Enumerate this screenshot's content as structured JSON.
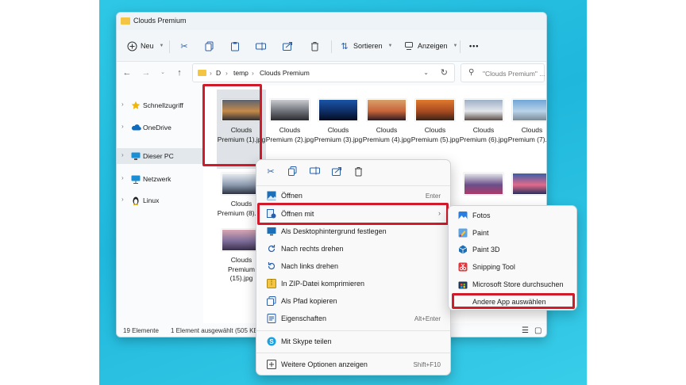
{
  "window": {
    "title": "Clouds Premium"
  },
  "toolbar": {
    "new_label": "Neu",
    "sort_label": "Sortieren",
    "view_label": "Anzeigen",
    "more_label": "•••"
  },
  "address": {
    "crumbs": [
      "D",
      "temp",
      "Clouds Premium"
    ],
    "search_placeholder": "\"Clouds Premium\" ..."
  },
  "sidebar": {
    "items": [
      {
        "label": "Schnellzugriff",
        "icon": "star-icon"
      },
      {
        "label": "OneDrive",
        "icon": "cloud-icon"
      },
      {
        "label": "Dieser PC",
        "icon": "monitor-icon",
        "selected": true
      },
      {
        "label": "Netzwerk",
        "icon": "network-icon"
      },
      {
        "label": "Linux",
        "icon": "penguin-icon"
      }
    ]
  },
  "files": [
    {
      "label": "Clouds Premium (1).jpg",
      "colors": [
        "#5d6470",
        "#c58a4a",
        "#2f3036"
      ]
    },
    {
      "label": "Clouds Premium (2).jpg",
      "colors": [
        "#c9cbd0",
        "#6e7178",
        "#2b2c30"
      ]
    },
    {
      "label": "Clouds Premium (3).jpg",
      "colors": [
        "#1a55a8",
        "#0e2e66",
        "#050b20"
      ]
    },
    {
      "label": "Clouds Premium (4).jpg",
      "colors": [
        "#d9a06a",
        "#c8643a",
        "#2c1d22"
      ]
    },
    {
      "label": "Clouds Premium (5).jpg",
      "colors": [
        "#e07a2e",
        "#a84a20",
        "#3a2418"
      ]
    },
    {
      "label": "Clouds Premium (6).jpg",
      "colors": [
        "#9db0c7",
        "#e3e6ea",
        "#5a4c46"
      ]
    },
    {
      "label": "Clouds Premium (7).jpg",
      "colors": [
        "#6fa6d6",
        "#b9d3e8",
        "#7a8a96"
      ]
    },
    {
      "label": "Clouds Premium (8).jpg",
      "colors": [
        "#e9edf2",
        "#8d9bb0",
        "#2d3442"
      ]
    },
    {
      "label": "Clouds Premium (15).jpg",
      "colors": [
        "#d9a6b3",
        "#7c6d9a",
        "#3a2f4a"
      ]
    },
    {
      "label": "",
      "colors": [
        "#e4e6ea",
        "#6a4f8a",
        "#b03a6a"
      ]
    },
    {
      "label": "",
      "colors": [
        "#3a5ea8",
        "#e26a8a",
        "#29305e"
      ]
    }
  ],
  "status": {
    "count": "19 Elemente",
    "selection": "1 Element ausgewählt (505 KB"
  },
  "context_menu": {
    "items": [
      {
        "label": "Öffnen",
        "shortcut": "Enter",
        "icon": "image-icon"
      },
      {
        "label": "Öffnen mit",
        "shortcut": "",
        "icon": "open-with-icon",
        "submenu": true
      },
      {
        "label": "Als Desktophintergrund festlegen",
        "shortcut": "",
        "icon": "desktop-icon"
      },
      {
        "label": "Nach rechts drehen",
        "shortcut": "",
        "icon": "rotate-right-icon"
      },
      {
        "label": "Nach links drehen",
        "shortcut": "",
        "icon": "rotate-left-icon"
      },
      {
        "label": "In ZIP-Datei komprimieren",
        "shortcut": "",
        "icon": "zip-icon"
      },
      {
        "label": "Als Pfad kopieren",
        "shortcut": "",
        "icon": "copy-path-icon"
      },
      {
        "label": "Eigenschaften",
        "shortcut": "Alt+Enter",
        "icon": "properties-icon"
      },
      {
        "label": "Mit Skype teilen",
        "shortcut": "",
        "icon": "skype-icon"
      },
      {
        "label": "Weitere Optionen anzeigen",
        "shortcut": "Shift+F10",
        "icon": "more-options-icon"
      }
    ]
  },
  "submenu": {
    "items": [
      {
        "label": "Fotos",
        "icon": "photos-icon"
      },
      {
        "label": "Paint",
        "icon": "paint-icon"
      },
      {
        "label": "Paint 3D",
        "icon": "paint-3d-icon"
      },
      {
        "label": "Snipping Tool",
        "icon": "snipping-tool-icon"
      },
      {
        "label": "Microsoft Store durchsuchen",
        "icon": "store-icon"
      },
      {
        "label": "Andere App auswählen",
        "icon": ""
      }
    ]
  },
  "colors": {
    "highlight": "#d11a2a",
    "accent": "#2a5fa8",
    "folder": "#f4c542"
  }
}
